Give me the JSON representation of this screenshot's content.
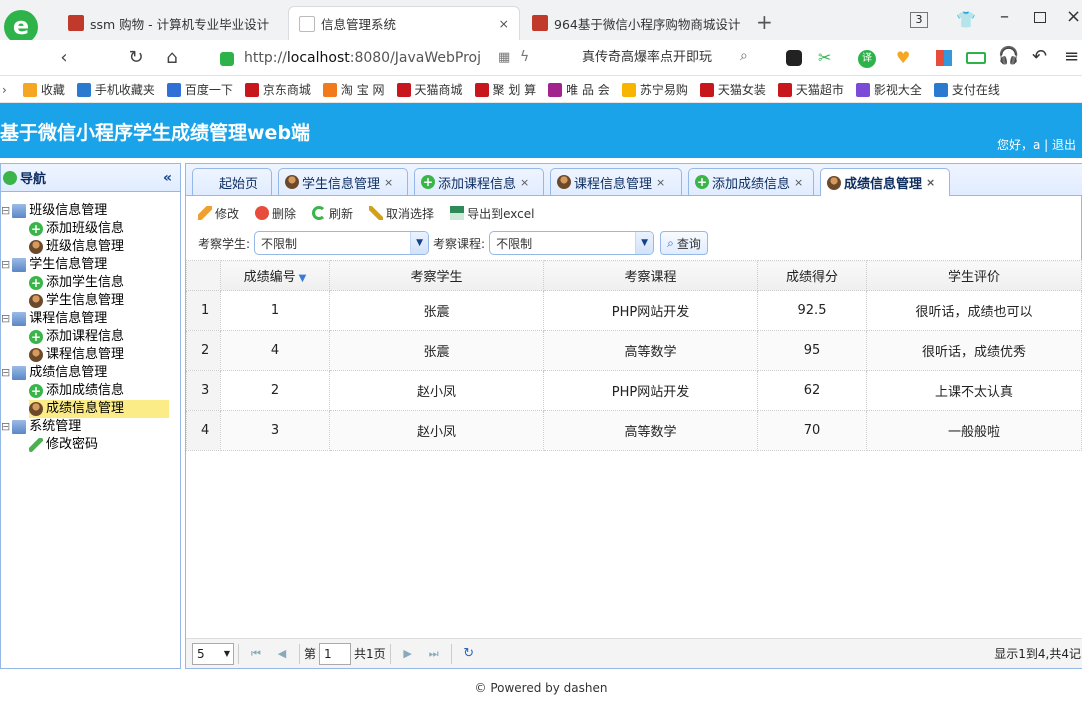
{
  "browser": {
    "tabs": [
      {
        "title": "ssm 购物 - 计算机专业毕业设计",
        "active": false
      },
      {
        "title": "信息管理系统",
        "active": true
      },
      {
        "title": "964基于微信小程序购物商城设计",
        "active": false
      }
    ],
    "new_tab": "+",
    "tab_count": "3",
    "url": "http://localhost:8080/JavaWebProj",
    "url_host": "localhost",
    "url_prefix": "http://",
    "url_rest": ":8080/JavaWebProj",
    "search_hint": "真传奇高爆率点开即玩",
    "bookmarks": [
      "收藏",
      "手机收藏夹",
      "百度一下",
      "京东商城",
      "淘 宝 网",
      "天猫商城",
      "聚 划 算",
      "唯 品 会",
      "苏宁易购",
      "天猫女装",
      "天猫超市",
      "影视大全",
      "支付在线"
    ],
    "bookmark_colors": [
      "#f5a623",
      "#2a7bd0",
      "#2f6fd6",
      "#c8161d",
      "#f27a1a",
      "#c8161d",
      "#c8161d",
      "#a3238e",
      "#f7b500",
      "#c8161d",
      "#c8161d",
      "#7b4bd8",
      "#2a7bd0"
    ]
  },
  "app": {
    "title": "基于微信小程序学生成绩管理web端",
    "greeting": "您好，a | 退出",
    "header_color": "#1aa3e8"
  },
  "sidebar": {
    "title": "导航",
    "collapse": "«",
    "nodes": [
      {
        "label": "班级信息管理",
        "icon": "folder-icon",
        "level": 0
      },
      {
        "label": "添加班级信息",
        "icon": "add-icon",
        "level": 1
      },
      {
        "label": "班级信息管理",
        "icon": "user-icon",
        "level": 1
      },
      {
        "label": "学生信息管理",
        "icon": "folder-icon",
        "level": 0
      },
      {
        "label": "添加学生信息",
        "icon": "add-icon",
        "level": 1
      },
      {
        "label": "学生信息管理",
        "icon": "user-icon",
        "level": 1
      },
      {
        "label": "课程信息管理",
        "icon": "folder-icon",
        "level": 0
      },
      {
        "label": "添加课程信息",
        "icon": "add-icon",
        "level": 1
      },
      {
        "label": "课程信息管理",
        "icon": "user-icon",
        "level": 1
      },
      {
        "label": "成绩信息管理",
        "icon": "folder-icon",
        "level": 0
      },
      {
        "label": "添加成绩信息",
        "icon": "add-icon",
        "level": 1
      },
      {
        "label": "成绩信息管理",
        "icon": "user-icon",
        "level": 1,
        "selected": true
      },
      {
        "label": "系统管理",
        "icon": "folder-icon",
        "level": 0
      },
      {
        "label": "修改密码",
        "icon": "pen-icon",
        "level": 1
      }
    ]
  },
  "tabs": [
    {
      "label": "起始页",
      "icon": "",
      "closable": false,
      "active": false
    },
    {
      "label": "学生信息管理",
      "icon": "user-icon",
      "closable": true,
      "active": false
    },
    {
      "label": "添加课程信息",
      "icon": "add-icon",
      "closable": true,
      "active": false
    },
    {
      "label": "课程信息管理",
      "icon": "user-icon",
      "closable": true,
      "active": false
    },
    {
      "label": "添加成绩信息",
      "icon": "add-icon",
      "closable": true,
      "active": false
    },
    {
      "label": "成绩信息管理",
      "icon": "user-icon",
      "closable": true,
      "active": true
    }
  ],
  "toolbar": {
    "edit": "修改",
    "delete": "删除",
    "refresh": "刷新",
    "unselect": "取消选择",
    "export": "导出到excel"
  },
  "filters": {
    "student_label": "考察学生:",
    "student_value": "不限制",
    "course_label": "考察课程:",
    "course_value": "不限制",
    "query": "查询"
  },
  "grid": {
    "columns": [
      "成绩编号",
      "考察学生",
      "考察课程",
      "成绩得分",
      "学生评价"
    ],
    "rows": [
      {
        "rownum": "1",
        "cells": [
          "1",
          "张震",
          "PHP网站开发",
          "92.5",
          "很听话，成绩也可以"
        ]
      },
      {
        "rownum": "2",
        "cells": [
          "4",
          "张震",
          "高等数学",
          "95",
          "很听话，成绩优秀"
        ]
      },
      {
        "rownum": "3",
        "cells": [
          "2",
          "赵小凤",
          "PHP网站开发",
          "62",
          "上课不太认真"
        ]
      },
      {
        "rownum": "4",
        "cells": [
          "3",
          "赵小凤",
          "高等数学",
          "70",
          "一般般啦"
        ]
      }
    ]
  },
  "pager": {
    "page_size": "5",
    "page_prefix": "第",
    "page": "1",
    "page_suffix": "共1页",
    "info": "显示1到4,共4记"
  },
  "footer": "© Powered by dashen"
}
